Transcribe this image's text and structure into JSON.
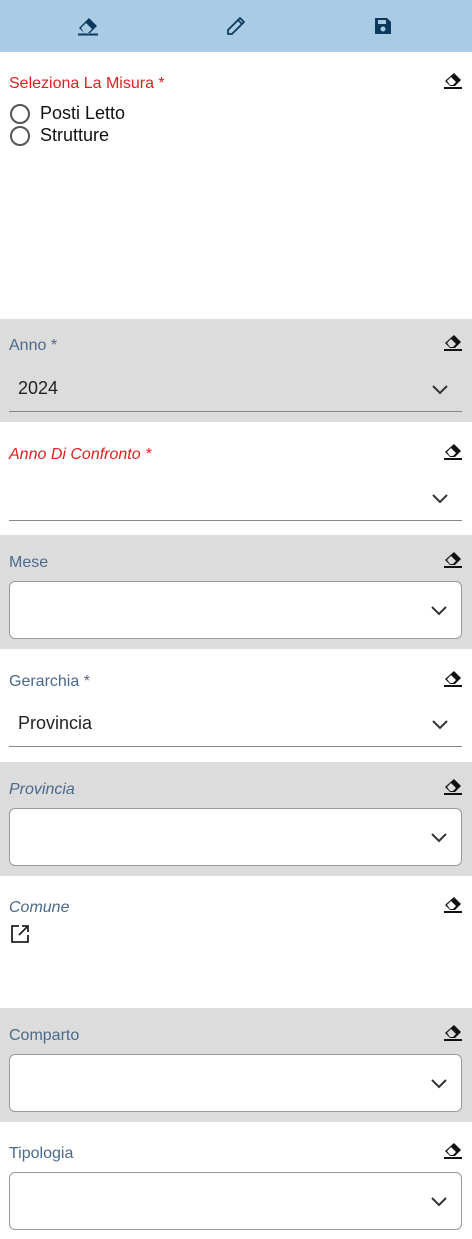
{
  "toolbar": {
    "buttons": [
      {
        "icon": "eraser-icon"
      },
      {
        "icon": "pencil-icon"
      },
      {
        "icon": "save-icon"
      }
    ],
    "icon_color": "#0d3a5c",
    "background": "#a9cbe3"
  },
  "fields": {
    "misura": {
      "label": "Seleziona La Misura *",
      "options": [
        "Posti Letto",
        "Strutture"
      ]
    },
    "anno": {
      "label": "Anno *",
      "value": "2024"
    },
    "anno_confronto": {
      "label": "Anno Di Confronto *",
      "value": ""
    },
    "mese": {
      "label": "Mese",
      "value": ""
    },
    "gerarchia": {
      "label": "Gerarchia *",
      "value": "Provincia"
    },
    "provincia": {
      "label": "Provincia",
      "value": ""
    },
    "comune": {
      "label": "Comune"
    },
    "comparto": {
      "label": "Comparto",
      "value": ""
    },
    "tipologia": {
      "label": "Tipologia",
      "value": ""
    }
  },
  "colors": {
    "required_label": "#e02020",
    "label": "#4a6a8c",
    "gray_band": "#dcdcdc"
  }
}
